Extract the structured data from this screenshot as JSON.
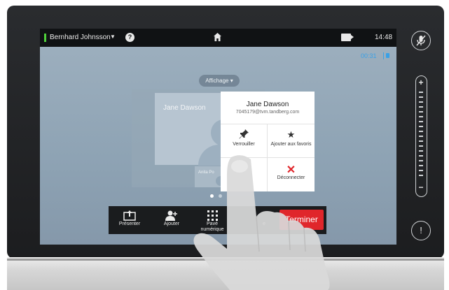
{
  "topbar": {
    "caller_name": "Bernhard Johnsson",
    "caret": "▼",
    "help": "?",
    "clock": "14:48"
  },
  "call": {
    "timer": "00:31"
  },
  "layout_button": {
    "label": "Affichage",
    "caret": "▾"
  },
  "tiles": {
    "main_name": "Jane Dawson",
    "small_name": "Anita Po"
  },
  "popup": {
    "name": "Jane Dawson",
    "address": "7045179@tvm.tandberg.com",
    "actions": [
      {
        "label": "Verrouiller",
        "icon": "pin-icon"
      },
      {
        "label": "Ajouter aux favoris",
        "icon": "star-icon"
      },
      {
        "label": "",
        "icon": ""
      },
      {
        "label": "Déconnecter",
        "icon": "close-icon"
      }
    ]
  },
  "bottombar": {
    "items": [
      {
        "label": "Présenter",
        "icon": "present-icon"
      },
      {
        "label": "Ajouter",
        "icon": "add-participant-icon"
      },
      {
        "label": "Pavé numérique",
        "icon": "keypad-icon"
      },
      {
        "label": "e",
        "icon": ""
      }
    ],
    "end_call": "Terminer"
  },
  "colors": {
    "accent_blue": "#3aa1e6",
    "end_red": "#e0262b",
    "status_green": "#4fd13a"
  }
}
